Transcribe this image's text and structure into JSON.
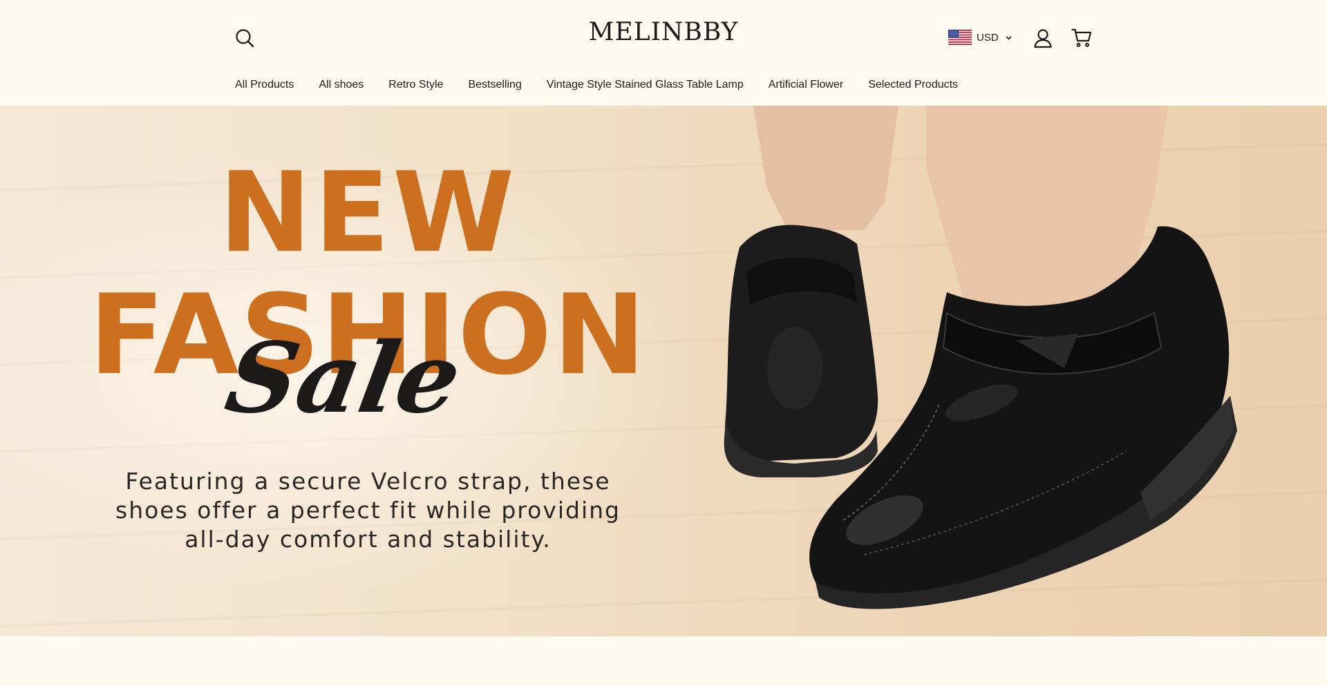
{
  "header": {
    "brand": "MELINBBY",
    "currency": {
      "code": "USD",
      "flag_icon": "us-flag-icon"
    },
    "icons": [
      "search-icon",
      "user-account-icon",
      "shopping-cart-icon",
      "chevron-down-icon"
    ]
  },
  "nav": {
    "items": [
      {
        "label": "All Products"
      },
      {
        "label": "All shoes"
      },
      {
        "label": "Retro Style"
      },
      {
        "label": "Bestselling"
      },
      {
        "label": "Vintage Style Stained Glass Table Lamp"
      },
      {
        "label": "Artificial Flower"
      },
      {
        "label": "Selected Products"
      }
    ]
  },
  "hero": {
    "line1": "NEW",
    "line2": "FASHION",
    "script": "Sale",
    "description_lines": [
      "Featuring a secure Velcro strap, these",
      "shoes offer a perfect fit while providing",
      "all-day comfort and stability."
    ],
    "accent_color": "#cc7020",
    "image": "black-velcro-wedge-shoes"
  },
  "colors": {
    "page_background": "#fffaf0",
    "text": "#1a1a1a"
  }
}
